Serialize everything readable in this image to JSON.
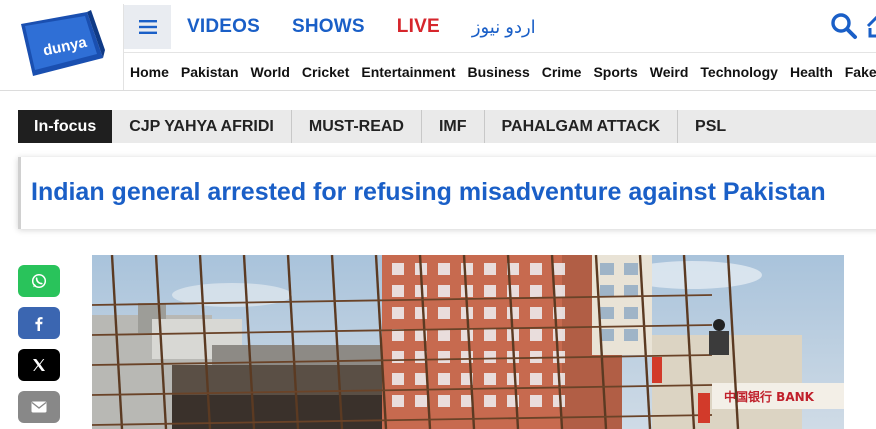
{
  "logo": {
    "text": "dunya"
  },
  "topnav": {
    "videos": "VIDEOS",
    "shows": "SHOWS",
    "live": "LIVE",
    "urdu": "اردو نیوز"
  },
  "categories": [
    "Home",
    "Pakistan",
    "World",
    "Cricket",
    "Entertainment",
    "Business",
    "Crime",
    "Sports",
    "Weird",
    "Technology",
    "Health",
    "Fake N"
  ],
  "focus": {
    "label": "In-focus",
    "tags": [
      "CJP YAHYA AFRIDI",
      "MUST-READ",
      "IMF",
      "PAHALGAM ATTACK",
      "PSL"
    ]
  },
  "article": {
    "headline": "Indian general arrested for refusing misadventure against Pakistan"
  },
  "photo_signage": {
    "bank": "中国银行 BANK"
  },
  "colors": {
    "brand_blue": "#1a5fc7",
    "live_red": "#d6262c",
    "whatsapp": "#29c35b",
    "facebook": "#3b66b1"
  },
  "share": [
    "whatsapp-icon",
    "facebook-icon",
    "x-icon",
    "email-icon"
  ]
}
